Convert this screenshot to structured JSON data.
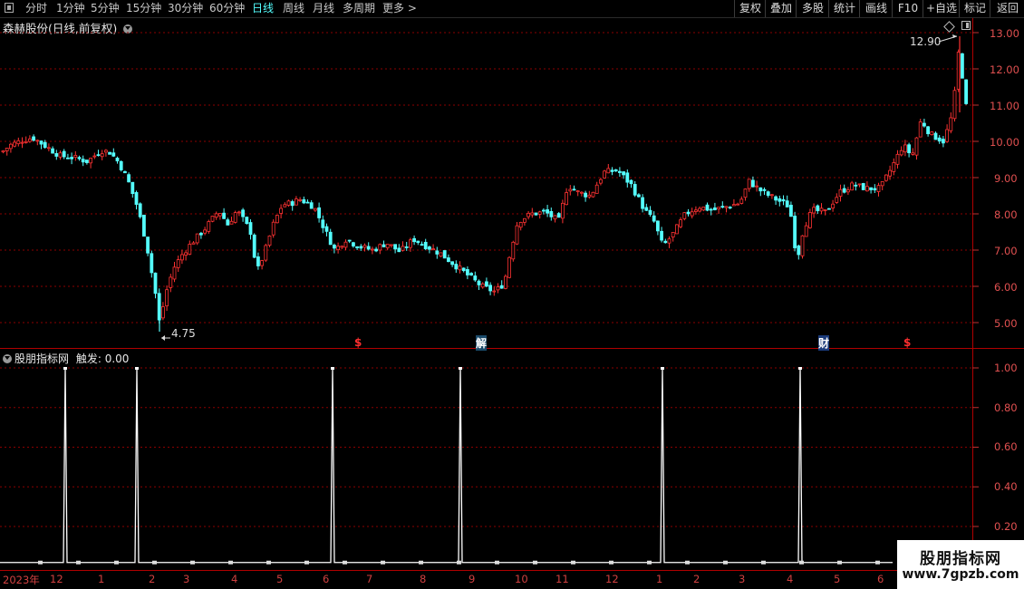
{
  "toolbar": {
    "periods": [
      "分时",
      "1分钟",
      "5分钟",
      "15分钟",
      "30分钟",
      "60分钟",
      "日线",
      "周线",
      "月线",
      "多周期",
      "更多 >"
    ],
    "active_period": "日线",
    "right": [
      "复权",
      "叠加",
      "多股",
      "统计",
      "画线",
      "F10",
      "+自选",
      "标记",
      "返回"
    ]
  },
  "main_chart": {
    "title": "森赫股份(日线,前复权)",
    "high_label": "12.90",
    "low_label": "4.75",
    "price_ticks": [
      "13.00",
      "12.00",
      "11.00",
      "10.00",
      "9.00",
      "8.00",
      "7.00",
      "6.00",
      "5.00"
    ],
    "markers": [
      "$",
      "解",
      "财",
      "$"
    ]
  },
  "indicator": {
    "title": "股朋指标网",
    "trigger_label": "触发:",
    "trigger_value": "0.00",
    "ticks": [
      "1.00",
      "0.80",
      "0.60",
      "0.40",
      "0.20"
    ]
  },
  "date_axis": [
    "2023年",
    "12",
    "1",
    "2",
    "3",
    "4",
    "5",
    "6",
    "7",
    "8",
    "9",
    "10",
    "11",
    "12",
    "1",
    "2",
    "3",
    "4",
    "5",
    "6"
  ],
  "watermark": {
    "line1": "股朋指标网",
    "line2": "www.7gpzb.com"
  },
  "colors": {
    "up": "#ff3232",
    "down": "#54ffff",
    "grid": "#8b0000",
    "axis_text": "#e05050",
    "active": "#54ffff"
  },
  "chart_data": [
    {
      "type": "candlestick",
      "title": "森赫股份(日线,前复权)",
      "y_range": [
        4.6,
        13.2
      ],
      "y_ticks": [
        5,
        6,
        7,
        8,
        9,
        10,
        11,
        12,
        13
      ],
      "x_labels": [
        "2023年",
        "12",
        "1",
        "2",
        "3",
        "4",
        "5",
        "6",
        "7",
        "8",
        "9",
        "10",
        "11",
        "12",
        "1",
        "2",
        "3",
        "4",
        "5",
        "6"
      ],
      "close_path": [
        [
          0,
          9.7
        ],
        [
          10,
          9.9
        ],
        [
          25,
          10.05
        ],
        [
          35,
          10.1
        ],
        [
          50,
          9.85
        ],
        [
          65,
          9.6
        ],
        [
          80,
          9.55
        ],
        [
          95,
          9.45
        ],
        [
          110,
          9.75
        ],
        [
          120,
          9.7
        ],
        [
          130,
          9.4
        ],
        [
          140,
          8.9
        ],
        [
          150,
          8.2
        ],
        [
          160,
          7.2
        ],
        [
          170,
          5.8
        ],
        [
          175,
          4.9
        ],
        [
          180,
          5.7
        ],
        [
          190,
          6.5
        ],
        [
          200,
          6.9
        ],
        [
          210,
          7.2
        ],
        [
          225,
          7.6
        ],
        [
          240,
          8.1
        ],
        [
          250,
          7.7
        ],
        [
          260,
          8.1
        ],
        [
          268,
          7.8
        ],
        [
          275,
          7.5
        ],
        [
          282,
          6.4
        ],
        [
          290,
          6.9
        ],
        [
          300,
          7.7
        ],
        [
          310,
          8.25
        ],
        [
          320,
          8.3
        ],
        [
          330,
          8.4
        ],
        [
          345,
          8.2
        ],
        [
          360,
          7.4
        ],
        [
          368,
          7.0
        ],
        [
          380,
          7.3
        ],
        [
          395,
          7.1
        ],
        [
          410,
          7.0
        ],
        [
          425,
          7.2
        ],
        [
          440,
          6.95
        ],
        [
          455,
          7.3
        ],
        [
          470,
          7.1
        ],
        [
          485,
          6.9
        ],
        [
          500,
          6.6
        ],
        [
          515,
          6.3
        ],
        [
          530,
          6.0
        ],
        [
          545,
          5.85
        ],
        [
          555,
          6.1
        ],
        [
          562,
          7.0
        ],
        [
          570,
          7.8
        ],
        [
          585,
          8.0
        ],
        [
          600,
          8.05
        ],
        [
          615,
          7.8
        ],
        [
          625,
          8.8
        ],
        [
          635,
          8.6
        ],
        [
          650,
          8.5
        ],
        [
          665,
          9.15
        ],
        [
          680,
          9.2
        ],
        [
          695,
          8.8
        ],
        [
          710,
          8.1
        ],
        [
          720,
          7.8
        ],
        [
          730,
          7.1
        ],
        [
          740,
          7.4
        ],
        [
          755,
          8.0
        ],
        [
          770,
          8.2
        ],
        [
          785,
          8.1
        ],
        [
          800,
          8.2
        ],
        [
          815,
          8.3
        ],
        [
          825,
          8.9
        ],
        [
          840,
          8.6
        ],
        [
          855,
          8.4
        ],
        [
          870,
          8.2
        ],
        [
          878,
          6.7
        ],
        [
          885,
          7.6
        ],
        [
          895,
          8.1
        ],
        [
          910,
          8.05
        ],
        [
          925,
          8.6
        ],
        [
          940,
          8.8
        ],
        [
          955,
          8.7
        ],
        [
          970,
          8.7
        ],
        [
          985,
          9.4
        ],
        [
          995,
          9.9
        ],
        [
          1005,
          9.6
        ],
        [
          1015,
          10.6
        ],
        [
          1025,
          10.2
        ],
        [
          1040,
          10.0
        ],
        [
          1050,
          10.8
        ],
        [
          1058,
          12.9
        ],
        [
          1062,
          11.1
        ],
        [
          1068,
          10.8
        ]
      ],
      "annotations": [
        {
          "label": "12.90",
          "value": 12.9
        },
        {
          "label": "4.75",
          "value": 4.75
        }
      ]
    },
    {
      "type": "line",
      "series": [
        {
          "name": "触发",
          "values": [
            0,
            1,
            0,
            1,
            0,
            1,
            0,
            1,
            0,
            1,
            0,
            1,
            0
          ]
        }
      ],
      "y_range": [
        0,
        1.05
      ],
      "y_ticks": [
        0.2,
        0.4,
        0.6,
        0.8,
        1.0
      ],
      "spike_x": [
        72,
        151,
        367,
        508,
        731,
        883
      ]
    }
  ]
}
